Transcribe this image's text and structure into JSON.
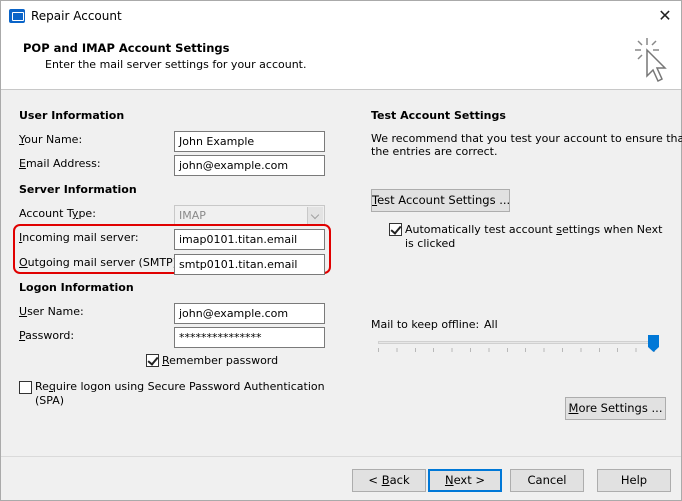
{
  "window": {
    "title": "Repair Account",
    "close_glyph": "✕"
  },
  "header": {
    "title": "POP and IMAP Account Settings",
    "subtitle": "Enter the mail server settings for your account."
  },
  "user_info": {
    "heading": "User Information",
    "name_label_u": "Y",
    "name_label_rest": "our Name:",
    "name_value": "John Example",
    "email_label_u": "E",
    "email_label_rest": "mail Address:",
    "email_value": "john@example.com"
  },
  "server_info": {
    "heading": "Server Information",
    "account_type_label_pre": "Account T",
    "account_type_label_u": "y",
    "account_type_label_post": "pe:",
    "account_type_value": "IMAP",
    "incoming_label_u": "I",
    "incoming_label_rest": "ncoming mail server:",
    "incoming_value": "imap0101.titan.email",
    "outgoing_label_u": "O",
    "outgoing_label_rest": "utgoing mail server (SMTP):",
    "outgoing_value": "smtp0101.titan.email"
  },
  "logon_info": {
    "heading": "Logon Information",
    "username_label_u": "U",
    "username_label_rest": "ser Name:",
    "username_value": "john@example.com",
    "password_label_u": "P",
    "password_label_rest": "assword:",
    "password_value": "***************",
    "remember_label_u": "R",
    "remember_label_rest": "emember password",
    "remember_checked": true,
    "spa_label_pre": "Re",
    "spa_label_u": "q",
    "spa_label_post": "uire logon using Secure Password Authentication",
    "spa_label_line2": "(SPA)",
    "spa_checked": false
  },
  "test_settings": {
    "heading": "Test Account Settings",
    "description_line1": "We recommend that you test your account to ensure that",
    "description_line2": "the entries are correct.",
    "test_button_u": "T",
    "test_button_rest": "est Account Settings ...",
    "auto_test_pre": "Automatically test account ",
    "auto_test_u": "s",
    "auto_test_post": "ettings when Next",
    "auto_test_line2": "is clicked",
    "auto_test_checked": true
  },
  "offline": {
    "label": "Mail to keep offline:",
    "value": "All",
    "slider_fraction": 1.0
  },
  "more_settings_button_u": "M",
  "more_settings_button_rest": "ore Settings ...",
  "footer": {
    "back_pre": "< ",
    "back_u": "B",
    "back_rest": "ack",
    "next_u": "N",
    "next_rest": "ext >",
    "cancel": "Cancel",
    "help": "Help"
  },
  "colors": {
    "highlight": "#e00000",
    "focus": "#0078d7",
    "slider_thumb": "#0078d7"
  }
}
